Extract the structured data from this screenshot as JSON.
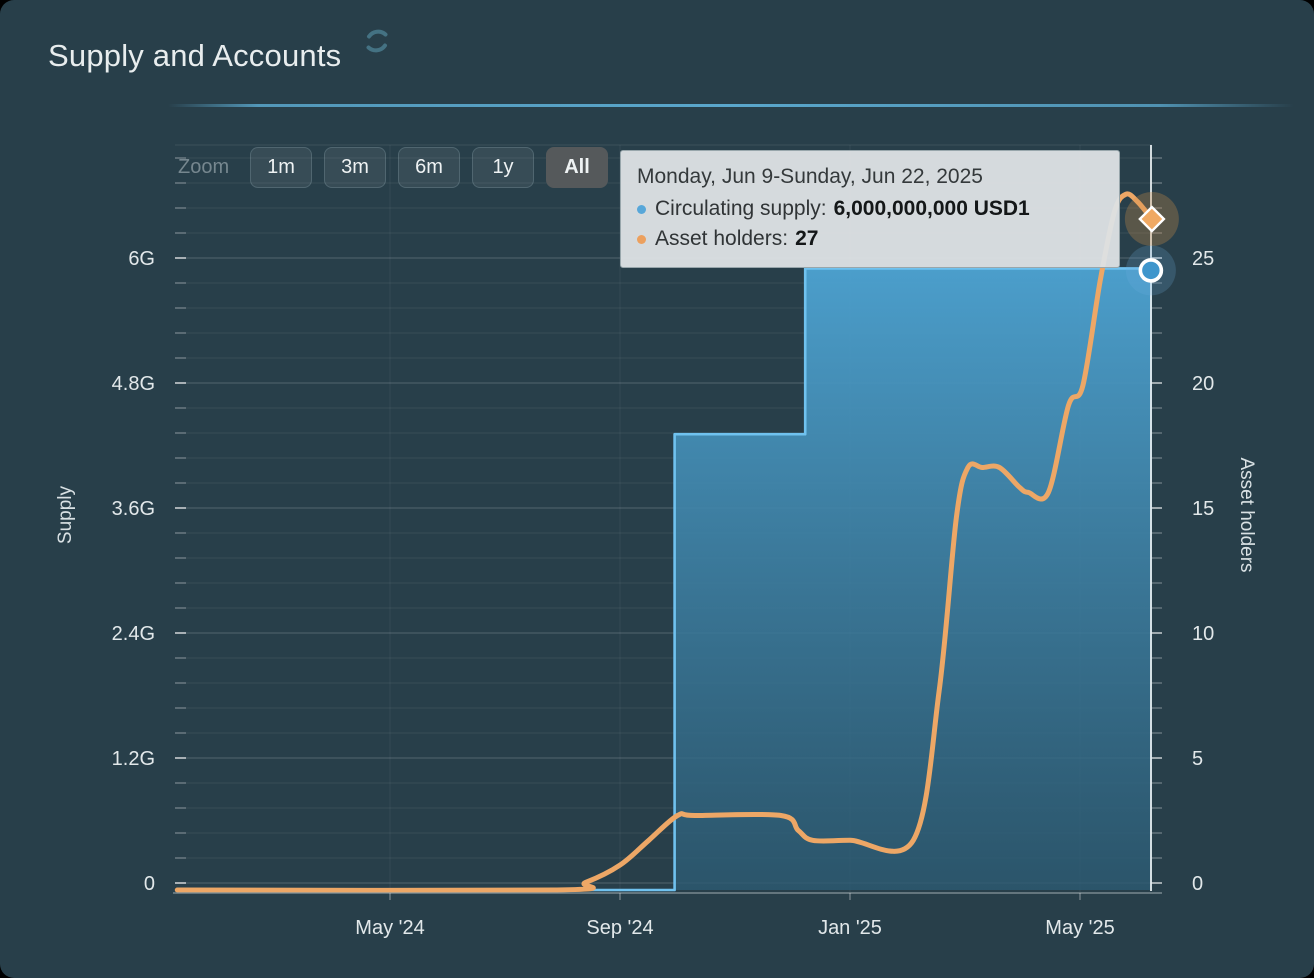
{
  "title": "Supply and Accounts",
  "toolbar": {
    "zoom_label": "Zoom",
    "buttons": [
      {
        "label": "1m",
        "selected": false
      },
      {
        "label": "3m",
        "selected": false
      },
      {
        "label": "6m",
        "selected": false
      },
      {
        "label": "1y",
        "selected": false
      },
      {
        "label": "All",
        "selected": true
      }
    ]
  },
  "tooltip": {
    "date_range": "Monday, Jun 9-Sunday, Jun 22, 2025",
    "rows": [
      {
        "label": "Circulating supply:",
        "value": "6,000,000,000 USD1",
        "bullet_color": "#57a7d9"
      },
      {
        "label": "Asset holders:",
        "value": "27",
        "bullet_color": "#eca05e"
      }
    ]
  },
  "chart_data": {
    "type": "area",
    "title": "Supply and Accounts",
    "x_axis": {
      "unit": "months since Jan 2024",
      "range_start": "Jan 2024",
      "range_end": "Jun 22, 2025",
      "ticks": [
        {
          "label": "May '24",
          "m": 4
        },
        {
          "label": "Sep '24",
          "m": 8
        },
        {
          "label": "Jan '25",
          "m": 12
        },
        {
          "label": "May '25",
          "m": 16
        }
      ]
    },
    "y_left": {
      "title": "Supply",
      "unit": "G = billions of USD1",
      "tick_labels": [
        "0",
        "1.2G",
        "2.4G",
        "3.6G",
        "4.8G",
        "6G"
      ],
      "tick_values": [
        0,
        1.2,
        2.4,
        3.6,
        4.8,
        6
      ]
    },
    "y_right": {
      "title": "Asset holders",
      "tick_values": [
        0,
        5,
        10,
        15,
        20,
        25
      ]
    },
    "grid": {
      "minor_step_right_units": 1,
      "major_step_right_units": 5
    },
    "legend_position": "none (tooltip only)",
    "series": [
      {
        "name": "Circulating supply",
        "type": "area",
        "axis": "left",
        "step": true,
        "color": "#70c2ef",
        "fill_top": "#4da3d2",
        "fill_bottom": "#2c5a72",
        "points": [
          [
            0.3,
            0
          ],
          [
            8.95,
            0
          ],
          [
            8.95,
            4.4
          ],
          [
            11.22,
            4.4
          ],
          [
            11.22,
            6.0
          ],
          [
            17.25,
            6.0
          ]
        ]
      },
      {
        "name": "Asset holders",
        "type": "line",
        "axis": "right",
        "color": "#eda766",
        "points": [
          [
            0.3,
            0
          ],
          [
            6.9,
            0
          ],
          [
            7.4,
            0.3
          ],
          [
            8.0,
            1
          ],
          [
            8.5,
            2
          ],
          [
            9.0,
            3
          ],
          [
            9.3,
            3
          ],
          [
            10.8,
            3
          ],
          [
            11.1,
            2.4
          ],
          [
            11.35,
            2
          ],
          [
            12.0,
            2
          ],
          [
            13.1,
            2
          ],
          [
            13.55,
            8
          ],
          [
            13.85,
            15
          ],
          [
            14.05,
            17
          ],
          [
            14.3,
            17
          ],
          [
            14.6,
            17
          ],
          [
            14.95,
            16.2
          ],
          [
            15.1,
            16
          ],
          [
            15.45,
            16
          ],
          [
            15.8,
            19.5
          ],
          [
            16.05,
            20.3
          ],
          [
            16.35,
            24.5
          ],
          [
            16.6,
            27.3
          ],
          [
            16.8,
            28
          ],
          [
            17.0,
            27.7
          ],
          [
            17.25,
            27
          ]
        ]
      }
    ],
    "hovered_point": {
      "date_range": "Monday, Jun 9-Sunday, Jun 22, 2025",
      "circulating_supply": "6,000,000,000 USD1",
      "asset_holders": 27
    },
    "markers": [
      {
        "series": "Asset holders",
        "m": 17.25,
        "value": 27,
        "shape": "diamond",
        "color": "#f0a963"
      },
      {
        "series": "Circulating supply",
        "m": 17.25,
        "value": 6.0,
        "shape": "circle",
        "color": "#3f96cc"
      }
    ]
  }
}
